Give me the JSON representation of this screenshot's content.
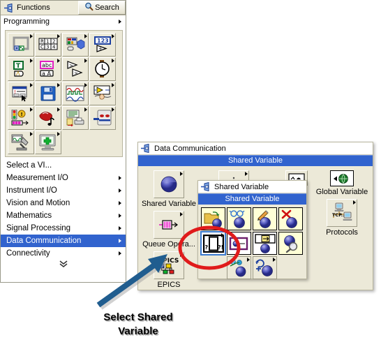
{
  "functions_palette": {
    "title": "Functions",
    "pin_icon": "pushpin-icon",
    "search_label": "Search",
    "search_icon": "magnifier-icon",
    "programming_label": "Programming",
    "icon_grid": [
      {
        "name": "structures-icon",
        "alt": "Structures"
      },
      {
        "name": "array-icon",
        "alt": "Array"
      },
      {
        "name": "cluster-class-variant-icon",
        "alt": "Cluster, Class, & Variant"
      },
      {
        "name": "numeric-icon",
        "alt": "Numeric"
      },
      {
        "name": "boolean-icon",
        "alt": "Boolean"
      },
      {
        "name": "string-icon",
        "alt": "String"
      },
      {
        "name": "comparison-icon",
        "alt": "Comparison"
      },
      {
        "name": "timing-icon",
        "alt": "Timing"
      },
      {
        "name": "dialog-user-interface-icon",
        "alt": "Dialog & User Interface"
      },
      {
        "name": "file-io-icon",
        "alt": "File I/O"
      },
      {
        "name": "waveform-icon",
        "alt": "Waveform"
      },
      {
        "name": "application-control-icon",
        "alt": "Application Control"
      },
      {
        "name": "synchronization-icon",
        "alt": "Synchronization"
      },
      {
        "name": "graphics-sound-icon",
        "alt": "Graphics & Sound"
      },
      {
        "name": "report-generation-icon",
        "alt": "Report Generation"
      },
      {
        "name": "dot-net-activex-icon",
        "alt": ".NET & ActiveX"
      },
      {
        "name": "measurement-io-icon",
        "alt": "Measurement I/O"
      },
      {
        "name": "addons-icon",
        "alt": "Add-ons"
      }
    ],
    "menu_items": [
      {
        "label": "Select a VI...",
        "has_submenu": false,
        "selected": false
      },
      {
        "label": "Measurement I/O",
        "has_submenu": true,
        "selected": false
      },
      {
        "label": "Instrument I/O",
        "has_submenu": true,
        "selected": false
      },
      {
        "label": "Vision and Motion",
        "has_submenu": true,
        "selected": false
      },
      {
        "label": "Mathematics",
        "has_submenu": true,
        "selected": false
      },
      {
        "label": "Signal Processing",
        "has_submenu": true,
        "selected": false
      },
      {
        "label": "Data Communication",
        "has_submenu": true,
        "selected": true
      },
      {
        "label": "Connectivity",
        "has_submenu": true,
        "selected": false
      }
    ],
    "expand_chevron": "»"
  },
  "datacomm_palette": {
    "title": "Data Communication",
    "pin_icon": "pushpin-icon",
    "subtitle_bar": "Shared Variable",
    "items": [
      {
        "label": "Shared Variable",
        "icon": "shared-variable-sphere-icon",
        "has_submenu": true
      },
      {
        "label": "Queue Opera...",
        "icon": "queue-operations-icon",
        "has_submenu": true
      },
      {
        "label": "EPICS",
        "icon": "epics-icon",
        "has_submenu": true
      },
      {
        "label": "Global Variable",
        "icon": "global-variable-globe-icon",
        "has_submenu": true
      },
      {
        "label": "Protocols",
        "icon": "protocols-tcp-icon",
        "has_submenu": true
      }
    ],
    "hidden_items": [
      {
        "icon": "datasocket-icon",
        "has_submenu": true
      },
      {
        "icon": "peer-to-peer-icon",
        "has_submenu": false
      }
    ]
  },
  "sharedvar_palette": {
    "title": "Shared Variable",
    "pin_icon": "pushpin-icon",
    "subtitle_bar": "Shared Variable",
    "items": [
      {
        "name": "open-variable-connection-icon",
        "style": "yellow",
        "has_submenu": false,
        "selected": false
      },
      {
        "name": "read-variable-icon",
        "style": "yellow",
        "has_submenu": false,
        "selected": false
      },
      {
        "name": "write-variable-icon",
        "style": "yellow",
        "has_submenu": false,
        "selected": false
      },
      {
        "name": "close-variable-connection-icon",
        "style": "yellow",
        "has_submenu": false,
        "selected": false
      },
      {
        "name": "select-shared-variable-icon",
        "style": "plain",
        "has_submenu": true,
        "selected": true
      },
      {
        "name": "variable-reference-icon",
        "style": "plain",
        "has_submenu": false,
        "selected": false
      },
      {
        "name": "variable-properties-icon",
        "style": "plain",
        "has_submenu": false,
        "selected": false
      },
      {
        "name": "find-variable-icon",
        "style": "yellow",
        "has_submenu": false,
        "selected": false
      },
      {
        "name": "deploy-library-icon",
        "style": "grey",
        "has_submenu": true,
        "selected": false
      },
      {
        "name": "refresh-variable-icon",
        "style": "grey",
        "has_submenu": true,
        "selected": false
      }
    ]
  },
  "annotation": {
    "caption_line1": "Select Shared",
    "caption_line2": "Variable",
    "highlight_shape": "red-ellipse",
    "highlight_color": "#e01b1b",
    "arrow_shape": "blue-arrow",
    "arrow_color": "#205d8f"
  }
}
